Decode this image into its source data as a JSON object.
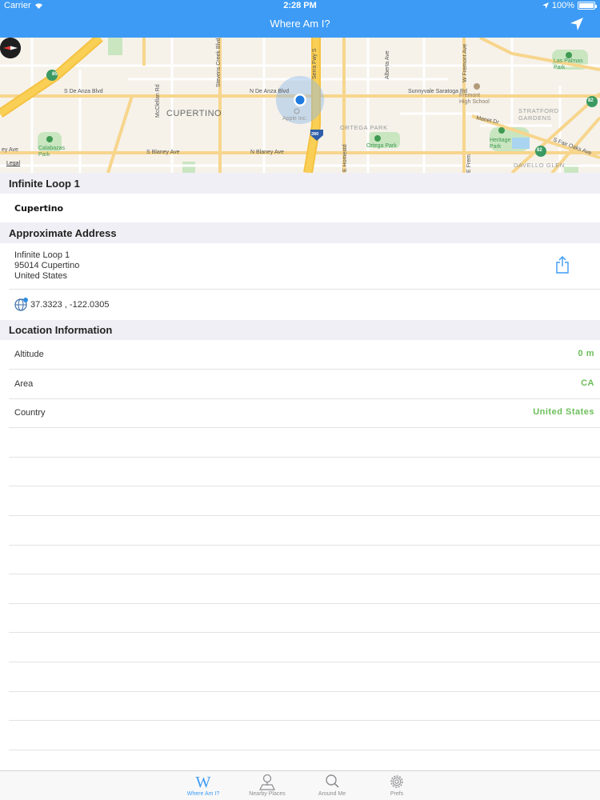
{
  "status_bar": {
    "carrier": "Carrier",
    "time": "2:28 PM",
    "battery": "100%"
  },
  "nav": {
    "title": "Where Am I?",
    "location_button": "location-arrow-icon"
  },
  "map": {
    "city": "CUPERTINO",
    "legal": "Legal",
    "roads": {
      "s_de_anza": "S De Anza Blvd",
      "n_de_anza": "N De Anza Blvd",
      "sunnyvale": "Sunnyvale Saratoga Rd",
      "s_blaney": "S Blaney Ave",
      "n_blaney": "N Blaney Ave",
      "blaney_left": "ey Ave",
      "mcclellan": "McClellan Rd",
      "stevens": "Stevens Creek Blvd",
      "serra": "Serra Fwy S",
      "alberta": "Alberta Ave",
      "w_fremont": "W Fremont Ave",
      "manet": "Manet Dr",
      "s_fair_oaks": "S Fair Oaks Ave",
      "e_homestead": "E Homestd",
      "e_fremont": "E Frem"
    },
    "places": {
      "apple": "Apple Inc.",
      "calabazas": "Calabazas\nPark",
      "ortega_area": "ORTEGA PARK",
      "ortega_park": "Ortega Park",
      "heritage": "Heritage\nPark",
      "las_palmas": "Las Palmas\nPark",
      "fremont_hs": "Fremont\nHigh School",
      "stratford": "STRATFORD\nGARDENS",
      "davello": "DAVELLO GLEN"
    },
    "shields": {
      "hwy85": "85",
      "hwy280": "280",
      "hwy82a": "82",
      "hwy82b": "82"
    }
  },
  "sections": {
    "place_header": "Infinite Loop 1",
    "place_city": "Cupertino",
    "address_header": "Approximate Address",
    "address_lines": [
      "Infinite Loop 1",
      "95014 Cupertino",
      "United States"
    ],
    "coordinates": "37.3323 , -122.0305",
    "info_header": "Location Information",
    "info_rows": [
      {
        "label": "Altitude",
        "value": "0 m"
      },
      {
        "label": "Area",
        "value": "CA"
      },
      {
        "label": "Country",
        "value": "United States"
      }
    ]
  },
  "tabs": [
    {
      "label": "Where Am I?",
      "icon": "w-letter-icon",
      "active": true
    },
    {
      "label": "Nearby Places",
      "icon": "map-pin-icon",
      "active": false
    },
    {
      "label": "Around Me",
      "icon": "search-icon",
      "active": false
    },
    {
      "label": "Prefs",
      "icon": "gear-icon",
      "active": false
    }
  ],
  "colors": {
    "accent": "#3d9bf5",
    "value_green": "#6cbe5a",
    "section_bg": "#f0eff5"
  }
}
